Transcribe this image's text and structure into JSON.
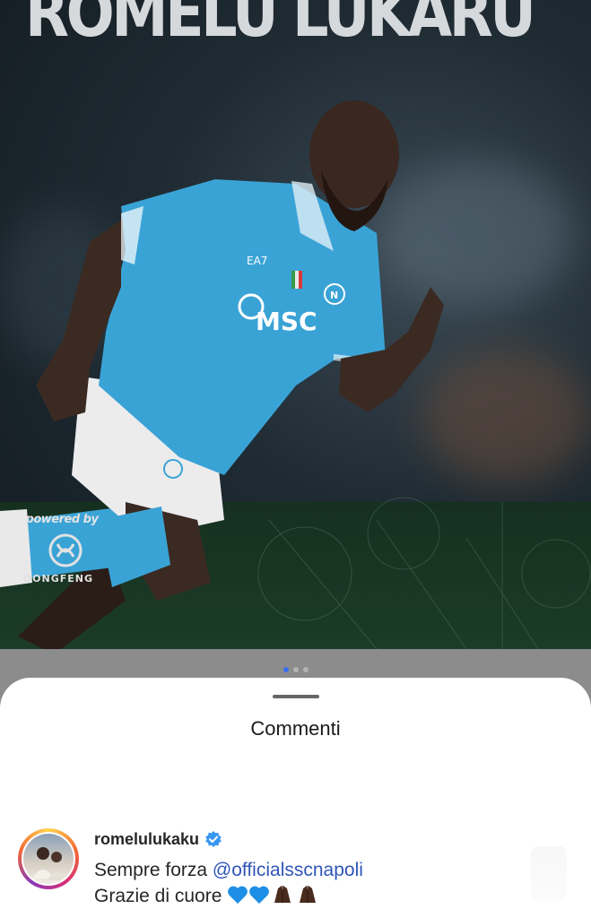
{
  "post": {
    "headline": "ROMELU LUKARU",
    "sponsor_powered": "powered by",
    "sponsor_name": "DONGFENG",
    "carousel": {
      "total": 3,
      "active_index": 0
    }
  },
  "sheet": {
    "title": "Commenti"
  },
  "comment": {
    "username": "romelulukaku",
    "verified": true,
    "text_prefix": "Sempre forza ",
    "mention": "@officialsscnapoli",
    "line2": "Grazie di cuore",
    "emojis": [
      "blue-heart",
      "blue-heart",
      "folded-hands-dark",
      "folded-hands-dark"
    ]
  },
  "colors": {
    "jersey": "#3aa3d6",
    "mention": "#2f55b8",
    "verified": "#3897f0",
    "active_dot": "#3a6df0"
  }
}
